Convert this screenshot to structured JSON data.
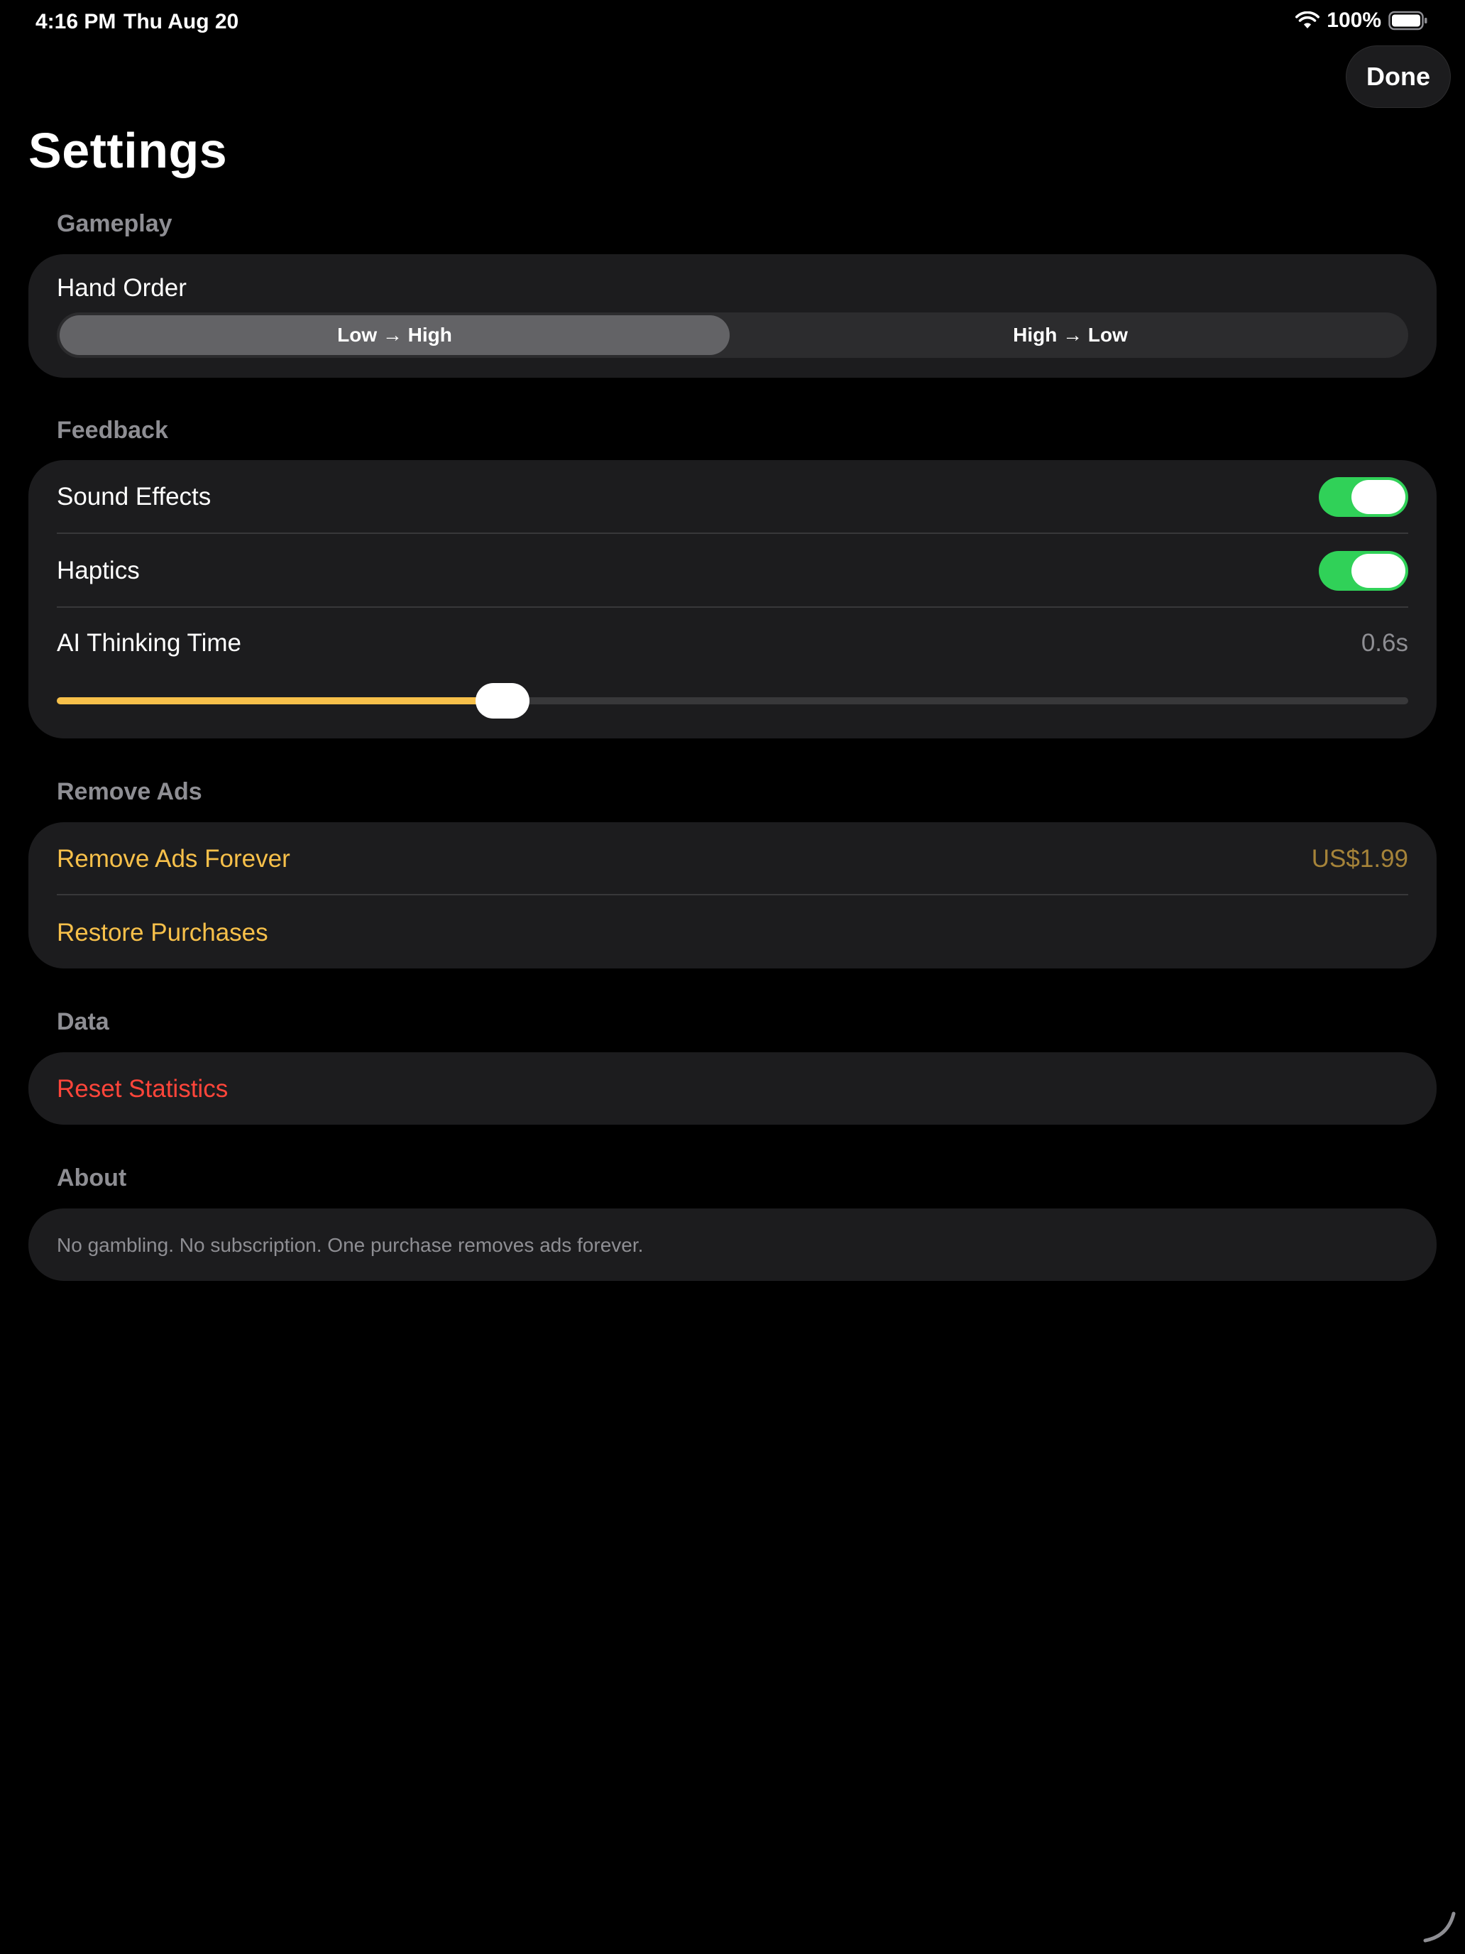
{
  "status_bar": {
    "time": "4:16 PM",
    "date": "Thu Aug 20",
    "battery": "100%"
  },
  "header": {
    "done_label": "Done",
    "title": "Settings"
  },
  "gameplay": {
    "header": "Gameplay",
    "hand_order_label": "Hand Order",
    "segments": [
      "Low → High",
      "High → Low"
    ],
    "selected_segment": "Low → High"
  },
  "feedback": {
    "header": "Feedback",
    "sound_label": "Sound Effects",
    "sound_on": true,
    "haptics_label": "Haptics",
    "haptics_on": true,
    "ai_label": "AI Thinking Time",
    "ai_value": "0.6s",
    "ai_slider_fraction": 0.33
  },
  "remove_ads": {
    "header": "Remove Ads",
    "forever_label": "Remove Ads Forever",
    "price": "US$1.99",
    "restore_label": "Restore Purchases"
  },
  "data_section": {
    "header": "Data",
    "reset_label": "Reset Statistics"
  },
  "about": {
    "header": "About",
    "text": "No gambling. No subscription. One purchase removes ads forever."
  },
  "colors": {
    "accent": "#f7c04a",
    "toggle_on": "#30d158",
    "danger": "#ff453a",
    "card_bg": "#1c1c1e"
  }
}
